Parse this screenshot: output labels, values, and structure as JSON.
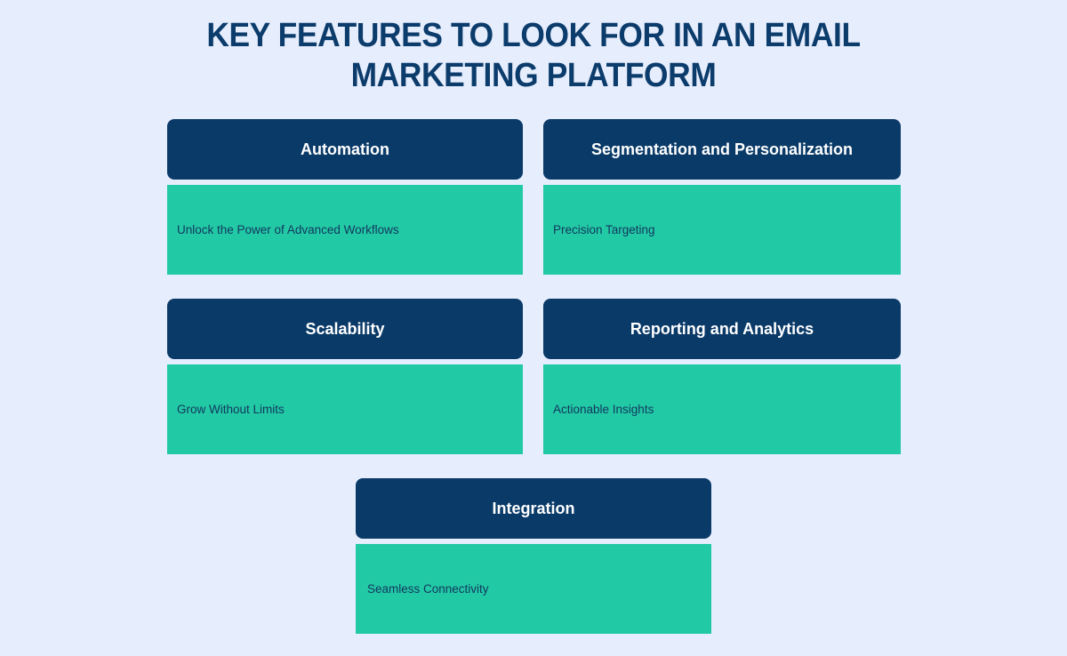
{
  "page": {
    "background_color": "#e6edfd",
    "title": "KEY FEATURES TO LOOK FOR IN AN EMAIL MARKETING PLATFORM"
  },
  "theme": {
    "header_color": "#0a3a68",
    "body_color": "#22c9a5",
    "header_text_color": "#ffffff",
    "body_text_color": "#12385e",
    "title_color": "#0b3c6b"
  },
  "cards": [
    {
      "id": "automation",
      "header": "Automation",
      "body": "Unlock the Power of Advanced Workflows"
    },
    {
      "id": "segmentation",
      "header": "Segmentation and Personalization",
      "body": "Precision Targeting"
    },
    {
      "id": "scalability",
      "header": "Scalability",
      "body": "Grow Without Limits"
    },
    {
      "id": "reporting",
      "header": "Reporting and Analytics",
      "body": "Actionable Insights"
    },
    {
      "id": "integration",
      "header": "Integration",
      "body": "Seamless Connectivity"
    }
  ]
}
